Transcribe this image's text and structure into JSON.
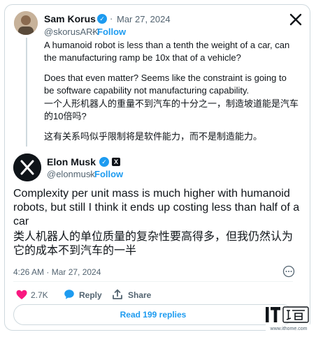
{
  "quoted_tweet": {
    "author_name": "Sam Korus",
    "handle": "@skorusARK",
    "date": "Mar 27, 2024",
    "separator": "·",
    "follow_label": "Follow",
    "paragraph_1": "A humanoid robot is less than a tenth the weight of a car, can the manufacturing ramp be 10x that of a vehicle?",
    "paragraph_2": "Does that even matter? Seems like the constraint is going to be software capability not manufacturing capability.",
    "translation_1": "一个人形机器人的重量不到汽车的十分之一，制造坡道能是汽车的10倍吗?",
    "translation_2": "这有关系吗似乎限制将是软件能力，而不是制造能力。"
  },
  "main_tweet": {
    "author_name": "Elon Musk",
    "handle": "@elonmusk",
    "separator": "·",
    "follow_label": "Follow",
    "text": "Complexity per unit mass is much higher with humanoid robots, but still I think it ends up costing less than half of a car",
    "translation": "类人机器人的单位质量的复杂性要高得多，但我仍然认为它的成本不到汽车的一半",
    "timestamp": "4:26 AM · Mar 27, 2024",
    "likes": "2.7K",
    "reply_label": "Reply",
    "share_label": "Share",
    "read_replies_label": "Read 199 replies"
  },
  "icons": {
    "x_logo": "x-logo-icon",
    "verified": "verified-badge-icon",
    "affiliate": "x-affiliate-badge-icon",
    "heart": "heart-icon",
    "reply": "reply-icon",
    "share": "share-icon",
    "more": "more-icon"
  },
  "watermark": {
    "brand": "IT之家",
    "url": "www.ithome.com"
  },
  "colors": {
    "accent": "#1d9bf0",
    "like": "#f91880",
    "text": "#0f1419",
    "muted": "#536471",
    "border": "#cfd9de"
  }
}
